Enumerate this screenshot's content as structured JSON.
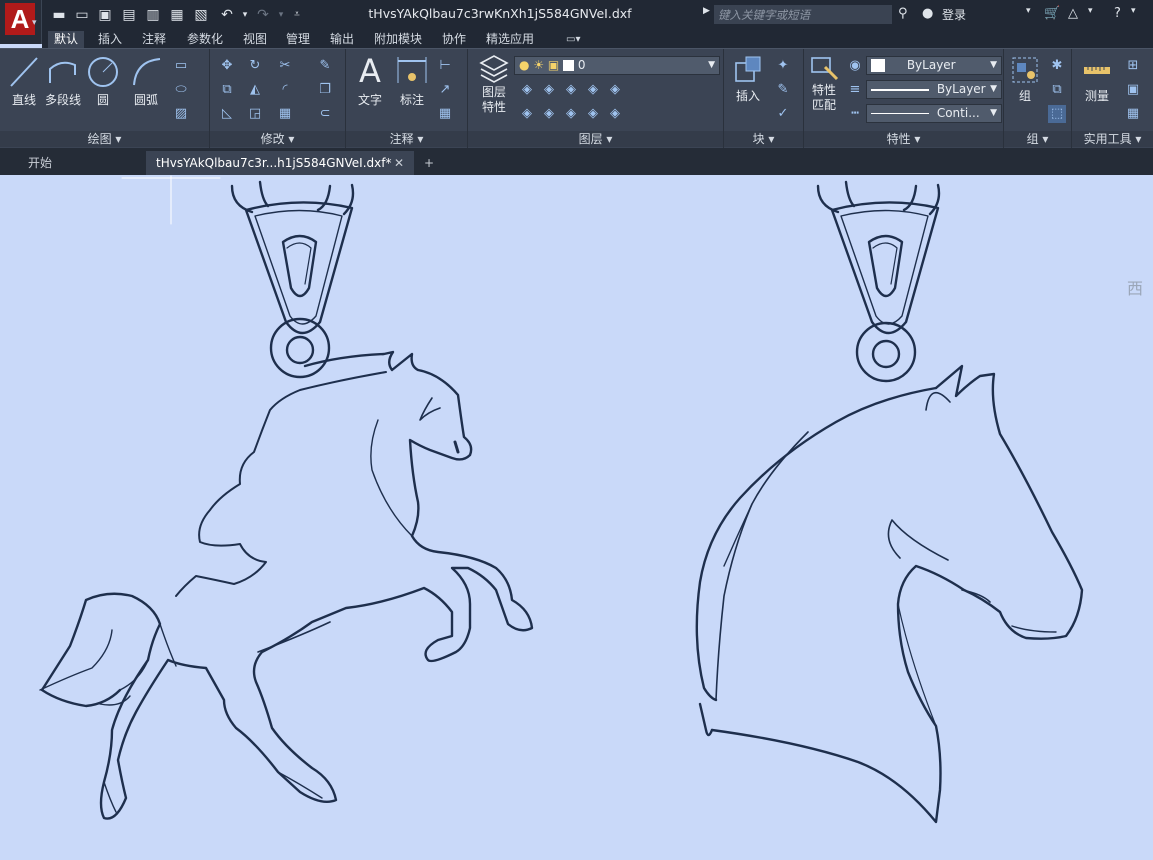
{
  "app": {
    "logo_letter": "A"
  },
  "title": {
    "document": "tHvsYAkQlbau7c3rwKnXh1jS584GNVeI.dxf"
  },
  "search": {
    "placeholder": "键入关键字或短语"
  },
  "user": {
    "login": "登录"
  },
  "menu_tabs": [
    "默认",
    "插入",
    "注释",
    "参数化",
    "视图",
    "管理",
    "输出",
    "附加模块",
    "协作",
    "精选应用"
  ],
  "active_tab": "默认",
  "ribbon": {
    "draw": {
      "label": "绘图 ▾",
      "line": "直线",
      "polyline": "多段线",
      "circle": "圆",
      "arc": "圆弧"
    },
    "modify": {
      "label": "修改 ▾"
    },
    "annotation": {
      "label": "注释 ▾",
      "text": "文字",
      "dimension": "标注"
    },
    "layers": {
      "label": "图层 ▾",
      "layer_props": "图层\n特性",
      "layer_props_1": "图层",
      "layer_props_2": "特性",
      "current_layer": "0"
    },
    "block": {
      "label": "块 ▾",
      "insert": "插入"
    },
    "properties": {
      "label": "特性 ▾",
      "match_1": "特性",
      "match_2": "匹配",
      "color": "ByLayer",
      "lineweight": "ByLayer",
      "linetype": "Conti..."
    },
    "groups": {
      "label": "组 ▾",
      "group": "组"
    },
    "utilities": {
      "label": "实用工具 ▾",
      "measure": "测量"
    }
  },
  "doc_tabs": [
    {
      "label": "开始"
    },
    {
      "label": "tHvsYAkQlbau7c3r...h1jS584GNVeI.dxf*"
    }
  ],
  "viewcube": {
    "label": "西"
  },
  "colors": {
    "canvas": "#c9d9f9",
    "stroke": "#1e2f4d",
    "ribbon": "#3b4454",
    "titlebar": "#212834",
    "accent": "#b01a1a"
  }
}
